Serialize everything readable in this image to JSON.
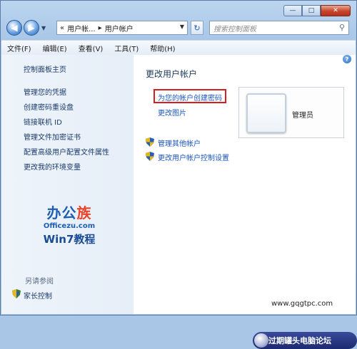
{
  "window": {
    "caption_buttons": [
      "—",
      "□",
      "✕"
    ]
  },
  "nav": {
    "back_icon": "back-arrow-icon",
    "forward_icon": "forward-arrow-icon",
    "address_prefix": "«",
    "address_segments": [
      "用户帐...",
      "▸",
      "用户帐户"
    ],
    "refresh_icon": "refresh-icon",
    "search_placeholder": "搜索控制面板"
  },
  "menu": [
    "文件(F)",
    "编辑(E)",
    "查看(V)",
    "工具(T)",
    "帮助(H)"
  ],
  "left_pane": {
    "home": "控制面板主页",
    "links": [
      "管理您的凭据",
      "创建密码重设盘",
      "链接联机 ID",
      "管理文件加密证书",
      "配置高级用户配置文件属性",
      "更改我的环境变量"
    ],
    "see_also": "另请参阅",
    "parental": "家长控制"
  },
  "main": {
    "title": "更改用户帐户",
    "create_password": "为您的帐户创建密码",
    "change_picture": "更改图片",
    "manage_other": "管理其他帐户",
    "uac_settings": "更改用户帐户控制设置",
    "user_name": "管理员",
    "help_icon": "?"
  },
  "watermark": {
    "title_a": "办公",
    "title_b": "族",
    "url": "Officezu.com",
    "win7": "Win7教程"
  },
  "badge": {
    "text": "过期罐头电脑论坛",
    "site": "www.gqgtpc.com"
  },
  "colors": {
    "link": "#1a56b8",
    "highlight_box": "#d52020",
    "close_button": "#c7442c"
  }
}
